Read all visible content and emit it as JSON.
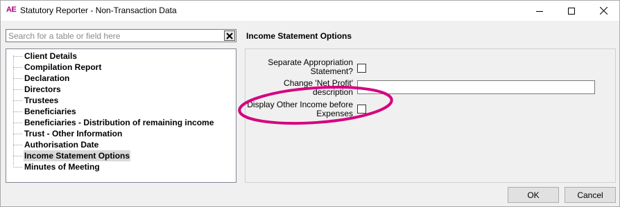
{
  "window": {
    "app_logo": "AE",
    "title": "Statutory Reporter - Non-Transaction Data"
  },
  "search": {
    "placeholder": "Search for a table or field here",
    "value": ""
  },
  "tree": {
    "items": [
      {
        "label": "Client Details",
        "selected": false
      },
      {
        "label": "Compilation Report",
        "selected": false
      },
      {
        "label": "Declaration",
        "selected": false
      },
      {
        "label": "Directors",
        "selected": false
      },
      {
        "label": "Trustees",
        "selected": false
      },
      {
        "label": "Beneficiaries",
        "selected": false
      },
      {
        "label": "Beneficiaries - Distribution of remaining income",
        "selected": false
      },
      {
        "label": "Trust - Other Information",
        "selected": false
      },
      {
        "label": "Authorisation Date",
        "selected": false
      },
      {
        "label": "Income Statement Options",
        "selected": true
      },
      {
        "label": "Minutes of Meeting",
        "selected": false
      }
    ]
  },
  "options": {
    "title": "Income Statement Options",
    "separate_appropriation": {
      "label_line1": "Separate Appropriation",
      "label_line2": "Statement?",
      "checked": false
    },
    "change_net_profit": {
      "label_line1": "Change 'Net Profit'",
      "label_line2": "description",
      "value": ""
    },
    "display_other_income": {
      "label_line1": "Display Other Income before",
      "label_line2": "Expenses",
      "checked": false
    }
  },
  "buttons": {
    "ok": "OK",
    "cancel": "Cancel"
  },
  "colors": {
    "highlight": "#d6007f",
    "logo": "#b0007a"
  }
}
